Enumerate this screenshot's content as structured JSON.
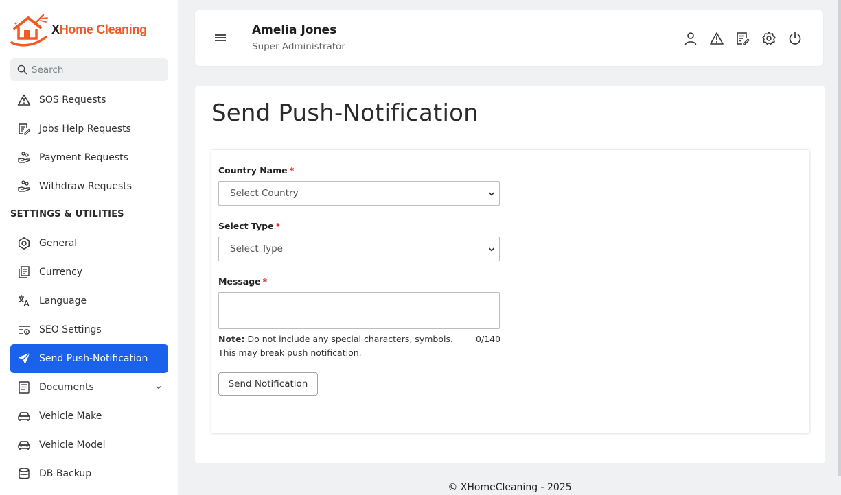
{
  "brand": {
    "logo_x": "X",
    "logo_rest": "Home Cleaning",
    "accent_color": "#f15a24"
  },
  "search": {
    "placeholder": "Search"
  },
  "sidebar": {
    "items_top": [
      {
        "label": "SOS Requests",
        "icon": "warning-triangle-icon"
      },
      {
        "label": "Jobs Help Requests",
        "icon": "edit-document-icon"
      },
      {
        "label": "Payment Requests",
        "icon": "hand-coins-icon"
      },
      {
        "label": "Withdraw Requests",
        "icon": "hand-coins-icon"
      }
    ],
    "section_title": "SETTINGS & UTILITIES",
    "items": [
      {
        "label": "General",
        "icon": "hexagon-gear-icon"
      },
      {
        "label": "Currency",
        "icon": "currency-notes-icon"
      },
      {
        "label": "Language",
        "icon": "translate-icon"
      },
      {
        "label": "SEO Settings",
        "icon": "seo-settings-icon"
      },
      {
        "label": "Send Push-Notification",
        "icon": "paper-plane-icon",
        "active": true
      },
      {
        "label": "Documents",
        "icon": "document-list-icon",
        "has_submenu": true
      },
      {
        "label": "Vehicle Make",
        "icon": "car-icon"
      },
      {
        "label": "Vehicle Model",
        "icon": "car-icon"
      },
      {
        "label": "DB Backup",
        "icon": "database-icon"
      }
    ],
    "active_color": "#1a62ec"
  },
  "header": {
    "user_name": "Amelia Jones",
    "user_role": "Super Administrator",
    "icons": [
      "user-icon",
      "warning-triangle-icon",
      "edit-document-icon",
      "settings-gear-icon",
      "power-icon"
    ]
  },
  "page": {
    "title": "Send Push-Notification",
    "form": {
      "country_label": "Country Name",
      "country_value": "Select Country",
      "type_label": "Select Type",
      "type_value": "Select Type",
      "message_label": "Message",
      "required_mark": "*",
      "note_label": "Note:",
      "note_text": " Do not include any special characters, symbols. This may break push notification.",
      "counter": "0/140",
      "submit_label": "Send Notification"
    }
  },
  "footer": {
    "text": "© XHomeCleaning - 2025"
  }
}
